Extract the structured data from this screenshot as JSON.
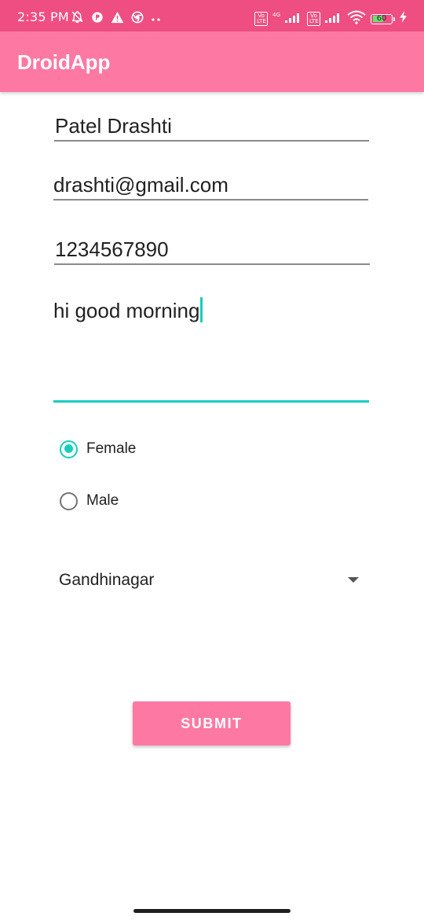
{
  "status_bar": {
    "time": "2:35 PM",
    "left_icons": [
      "muted-bell-icon",
      "p-badge-icon",
      "warning-icon",
      "chrome-icon",
      "more-dots-icon"
    ],
    "sim1_label": "Vo LTE",
    "network_label": "4G",
    "sim2_label": "Vo LTE",
    "battery_level": "60",
    "colors": {
      "background": "#ee4e82",
      "battery_fill": "#6de06d"
    }
  },
  "app_bar": {
    "title": "DroidApp",
    "background": "#fd79a3"
  },
  "form": {
    "name_value": "Patel Drashti",
    "email_value": "drashti@gmail.com",
    "phone_value": "1234567890",
    "message_value": "hi good morning",
    "accent_color": "#18cdbf"
  },
  "gender": {
    "options": [
      {
        "label": "Female",
        "checked": true
      },
      {
        "label": "Male",
        "checked": false
      }
    ]
  },
  "city_spinner": {
    "selected": "Gandhinagar"
  },
  "submit_button": {
    "label": "SUBMIT"
  }
}
